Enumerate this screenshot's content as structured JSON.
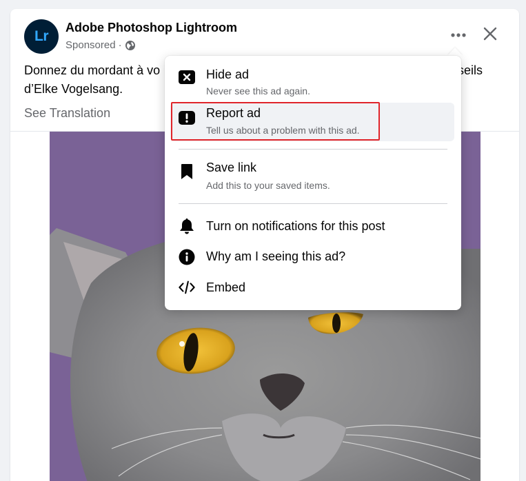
{
  "post": {
    "page_name": "Adobe Photoshop Lightroom",
    "avatar_text": "Lr",
    "sponsored_label": "Sponsored",
    "separator": " · ",
    "text_line1_left": "Donnez du mordant à vo",
    "text_line1_right": "seils",
    "text_line2": "d’Elke Vogelsang.",
    "see_translation": "See Translation",
    "icons": {
      "more": "more-horizontal-icon",
      "close": "close-icon",
      "privacy": "globe-icon"
    }
  },
  "menu": {
    "items": [
      {
        "id": "hide",
        "icon": "hide-icon",
        "label": "Hide ad",
        "sub": "Never see this ad again."
      },
      {
        "id": "report",
        "icon": "report-icon",
        "label": "Report ad",
        "sub": "Tell us about a problem with this ad."
      },
      {
        "id": "save",
        "icon": "bookmark-icon",
        "label": "Save link",
        "sub": "Add this to your saved items."
      },
      {
        "id": "notifications",
        "icon": "bell-icon",
        "label": "Turn on notifications for this post"
      },
      {
        "id": "why",
        "icon": "info-icon",
        "label": "Why am I seeing this ad?"
      },
      {
        "id": "embed",
        "icon": "code-icon",
        "label": "Embed"
      }
    ]
  },
  "colors": {
    "highlight": "#e0242a",
    "image_background": "#7a6296",
    "lightroom_blue": "#31a8ff",
    "lightroom_dark": "#001e36"
  }
}
